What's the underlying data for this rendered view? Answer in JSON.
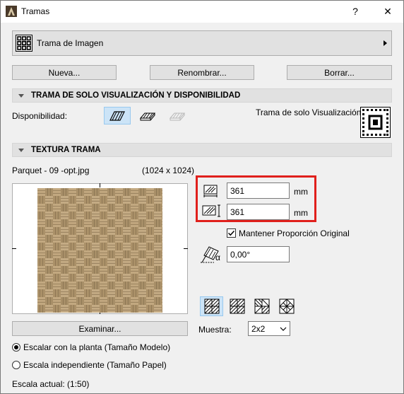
{
  "window": {
    "title": "Tramas",
    "help_label": "?",
    "close_label": "✕"
  },
  "pattern_selector": {
    "label": "Trama de Imagen"
  },
  "buttons": {
    "new": "Nueva...",
    "rename": "Renombrar...",
    "delete": "Borrar..."
  },
  "section_visibility": {
    "title": "TRAMA DE SOLO VISUALIZACIÓN Y DISPONIBILIDAD",
    "availability_label": "Disponibilidad:",
    "display_only_label": "Trama de solo Visualización:"
  },
  "section_texture": {
    "title": "TEXTURA TRAMA",
    "file_name": "Parquet - 09 -opt.jpg",
    "file_size": "(1024 x 1024)",
    "width_value": "361",
    "width_unit": "mm",
    "height_value": "361",
    "height_unit": "mm",
    "keep_ratio_label": "Mantener Proporción Original",
    "keep_ratio_checked": true,
    "angle_value": "0,00°",
    "alpha_symbol": "α",
    "browse_label": "Examinar...",
    "sample_label": "Muestra:",
    "sample_value": "2x2"
  },
  "scale_options": {
    "model": "Escalar con la planta (Tamaño Modelo)",
    "paper": "Escala independiente (Tamaño Papel)",
    "selected": "model"
  },
  "current_scale": "Escala actual: (1:50)",
  "colors": {
    "highlight": "#e0201c",
    "selected_bg": "#cce4f7",
    "wood": "#b39a72"
  }
}
